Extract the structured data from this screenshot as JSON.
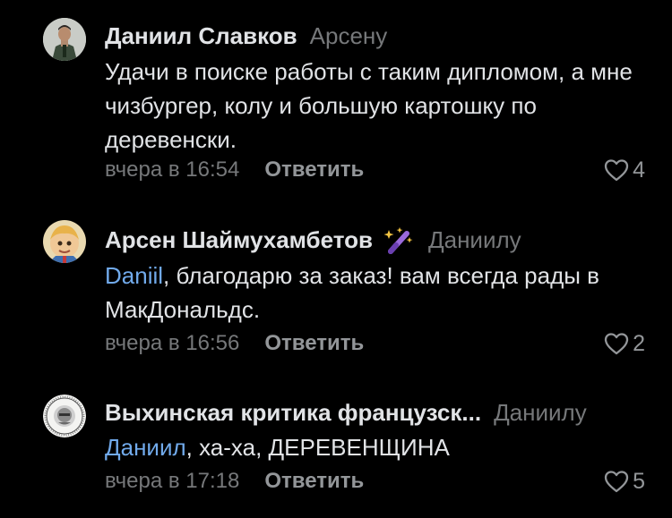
{
  "comments": [
    {
      "author": "Даниил Славков",
      "reply_to": "Арсену",
      "text": "Удачи в поиске работы с таким дипломом, а мне чизбургер, колу и большую картошку по деревенски.",
      "mention": "",
      "time": "вчера в 16:54",
      "reply_label": "Ответить",
      "likes": "4"
    },
    {
      "author": "Арсен Шаймухамбетов",
      "reply_to": "Даниилу",
      "mention": "Daniil",
      "text": ", благодарю за заказ! вам всегда рады в МакДональдс.",
      "time": "вчера в 16:56",
      "reply_label": "Ответить",
      "likes": "2"
    },
    {
      "author": "Выхинская критика французск...",
      "reply_to": "Даниилу",
      "mention": "Даниил",
      "text": ", ха-ха, ДЕРЕВЕНЩИНА",
      "time": "вчера в 17:18",
      "reply_label": "Ответить",
      "likes": "5"
    }
  ],
  "colors": {
    "background": "#000000",
    "text": "#e1e3e6",
    "secondary": "#76787a",
    "mention": "#71aaeb"
  },
  "icons": [
    "heart-outline-icon",
    "magic-wand-badge-icon"
  ]
}
